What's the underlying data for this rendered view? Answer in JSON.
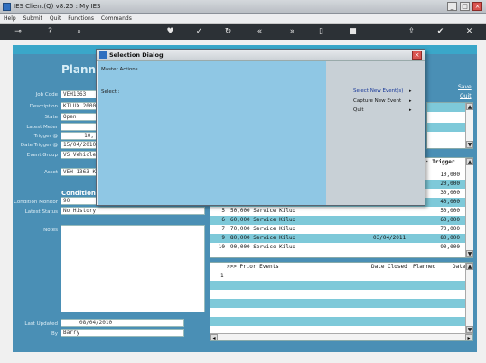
{
  "window": {
    "title": "IES Client(Q) v8.25 : My IES"
  },
  "menubar": [
    "Help",
    "Submit",
    "Quit",
    "Functions",
    "Commands"
  ],
  "toolbar_icons": [
    "key-icon",
    "help-icon",
    "search-icon",
    "heart-icon",
    "check-icon",
    "refresh-icon",
    "rewind-icon",
    "fast-forward-icon",
    "clipboard-icon",
    "square-icon",
    "upload-icon",
    "tick-circle-icon",
    "close-circle-icon"
  ],
  "form": {
    "title": "Planne",
    "labels": {
      "job_code": "Job Code",
      "description": "Description",
      "state": "State",
      "latest_meter": "Latest Meter",
      "trigger": "Trigger @",
      "date_trigger": "Date Trigger @",
      "event_group": "Event Group",
      "asset": "Asset",
      "condition_monitor": "Condition Monitor",
      "latest_status": "Latest Status",
      "notes": "Notes",
      "last_updated": "Last Updated",
      "by": "By"
    },
    "values": {
      "job_code": "VEH1363",
      "description": "KILUX 2000",
      "state": "Open",
      "latest_meter": "",
      "trigger": "10,",
      "date_trigger": "15/04/2010",
      "event_group": "VS Vehicle",
      "asset": "VEH-1363 K",
      "condition_monitor": "90",
      "latest_status": "No History",
      "last_updated": "08/04/2010",
      "by": "Barry"
    },
    "condition_heading": "Condition M"
  },
  "links": {
    "save": "Save",
    "quit": "Quit"
  },
  "trigger_grid": {
    "header": ": Trigger",
    "rows": [
      {
        "num": "",
        "event": "",
        "date": "",
        "trigger": "10,000"
      },
      {
        "num": "",
        "event": "",
        "date": "",
        "trigger": "20,000"
      },
      {
        "num": "",
        "event": "",
        "date": "",
        "trigger": "30,000"
      },
      {
        "num": "",
        "event": "",
        "date": "",
        "trigger": "40,000"
      },
      {
        "num": "5",
        "event": "50,000 Service Kilux",
        "date": "",
        "trigger": "50,000"
      },
      {
        "num": "6",
        "event": "60,000 Service Kilux",
        "date": "",
        "trigger": "60,000"
      },
      {
        "num": "7",
        "event": "70,000 Service Kilux",
        "date": "",
        "trigger": "70,000"
      },
      {
        "num": "9",
        "event": "80,000 Service Kilux",
        "date": "03/04/2011",
        "trigger": "80,000"
      },
      {
        "num": "10",
        "event": "90,000 Service Kilux",
        "date": "",
        "trigger": "90,000"
      }
    ]
  },
  "prior_grid": {
    "header": ">>> Prior Events",
    "col_closed": "Date Closed",
    "col_planned": "Planned",
    "col_date": "Date",
    "first_row": "1"
  },
  "dialog": {
    "title": "Selection Dialog",
    "heading": "Master Actions",
    "select_label": "Select :",
    "items": [
      "Select New Event(s)",
      "Capture New Event",
      "Quit"
    ],
    "arrow": "▸"
  }
}
